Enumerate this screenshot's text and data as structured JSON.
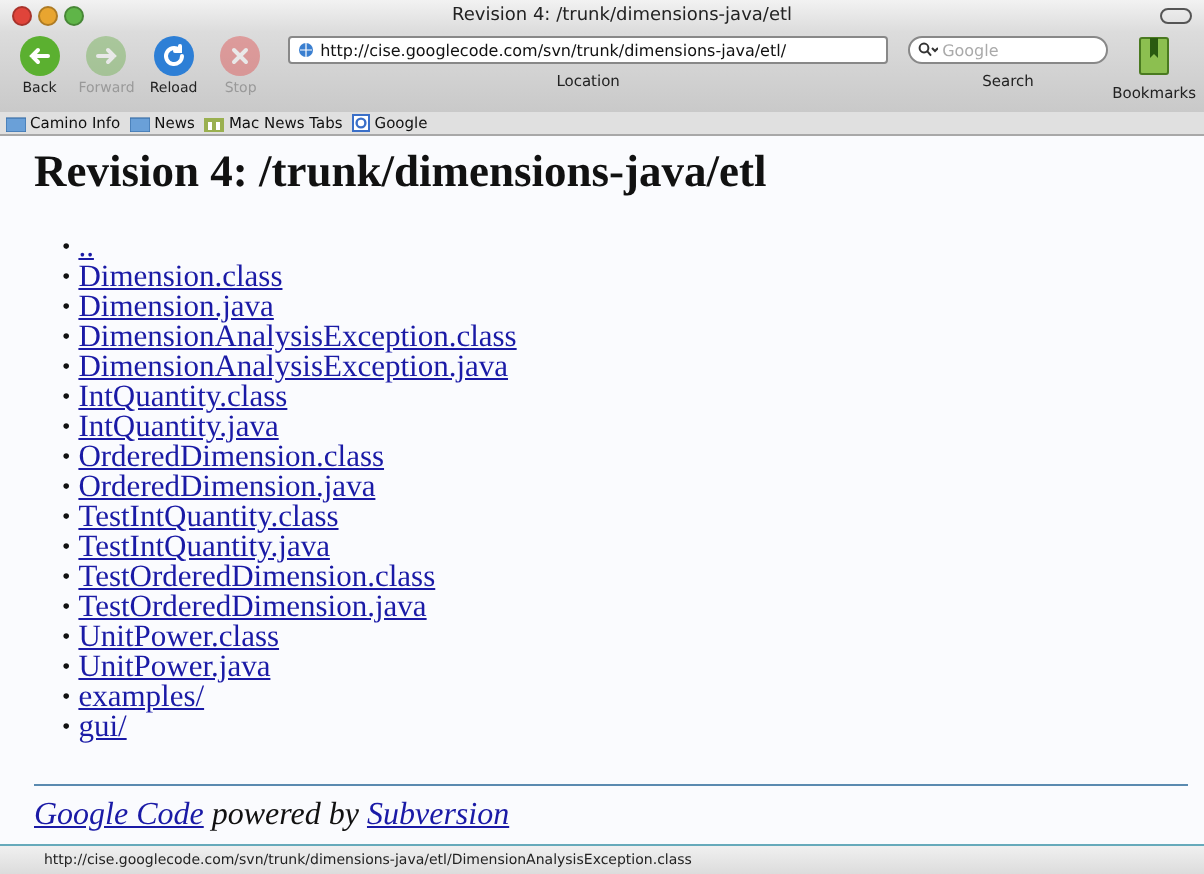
{
  "window": {
    "title": "Revision 4: /trunk/dimensions-java/etl"
  },
  "toolbar": {
    "buttons": [
      {
        "kind": "back",
        "label": "Back",
        "disabled": false
      },
      {
        "kind": "forward",
        "label": "Forward",
        "disabled": true
      },
      {
        "kind": "reload",
        "label": "Reload",
        "disabled": false
      },
      {
        "kind": "stop",
        "label": "Stop",
        "disabled": true
      }
    ],
    "location": {
      "value": "http://cise.googlecode.com/svn/trunk/dimensions-java/etl/",
      "label": "Location"
    },
    "search": {
      "placeholder": "Google",
      "label": "Search"
    },
    "bookmarks": {
      "label": "Bookmarks"
    }
  },
  "bookmarks_bar": [
    {
      "kind": "folder",
      "label": "Camino Info"
    },
    {
      "kind": "folder",
      "label": "News"
    },
    {
      "kind": "tabs",
      "label": "Mac News Tabs"
    },
    {
      "kind": "site",
      "label": "Google"
    }
  ],
  "page": {
    "heading": "Revision 4: /trunk/dimensions-java/etl",
    "items": [
      {
        "bullet": "•",
        "name": ".."
      },
      {
        "bullet": "•",
        "name": "Dimension.class"
      },
      {
        "bullet": "•",
        "name": "Dimension.java"
      },
      {
        "bullet": "•",
        "name": "DimensionAnalysisException.class"
      },
      {
        "bullet": "•",
        "name": "DimensionAnalysisException.java"
      },
      {
        "bullet": "•",
        "name": "IntQuantity.class"
      },
      {
        "bullet": "•",
        "name": "IntQuantity.java"
      },
      {
        "bullet": "•",
        "name": "OrderedDimension.class"
      },
      {
        "bullet": "•",
        "name": "OrderedDimension.java"
      },
      {
        "bullet": "•",
        "name": "TestIntQuantity.class"
      },
      {
        "bullet": "•",
        "name": "TestIntQuantity.java"
      },
      {
        "bullet": "•",
        "name": "TestOrderedDimension.class"
      },
      {
        "bullet": "•",
        "name": "TestOrderedDimension.java"
      },
      {
        "bullet": "•",
        "name": "UnitPower.class"
      },
      {
        "bullet": "•",
        "name": "UnitPower.java"
      },
      {
        "bullet": "•",
        "name": "examples/"
      },
      {
        "bullet": "•",
        "name": "gui/"
      }
    ],
    "footer": {
      "link_1": "Google Code",
      "text": "powered by",
      "link_2": "Subversion"
    }
  },
  "status_bar": "http://cise.googlecode.com/svn/trunk/dimensions-java/etl/DimensionAnalysisException.class"
}
